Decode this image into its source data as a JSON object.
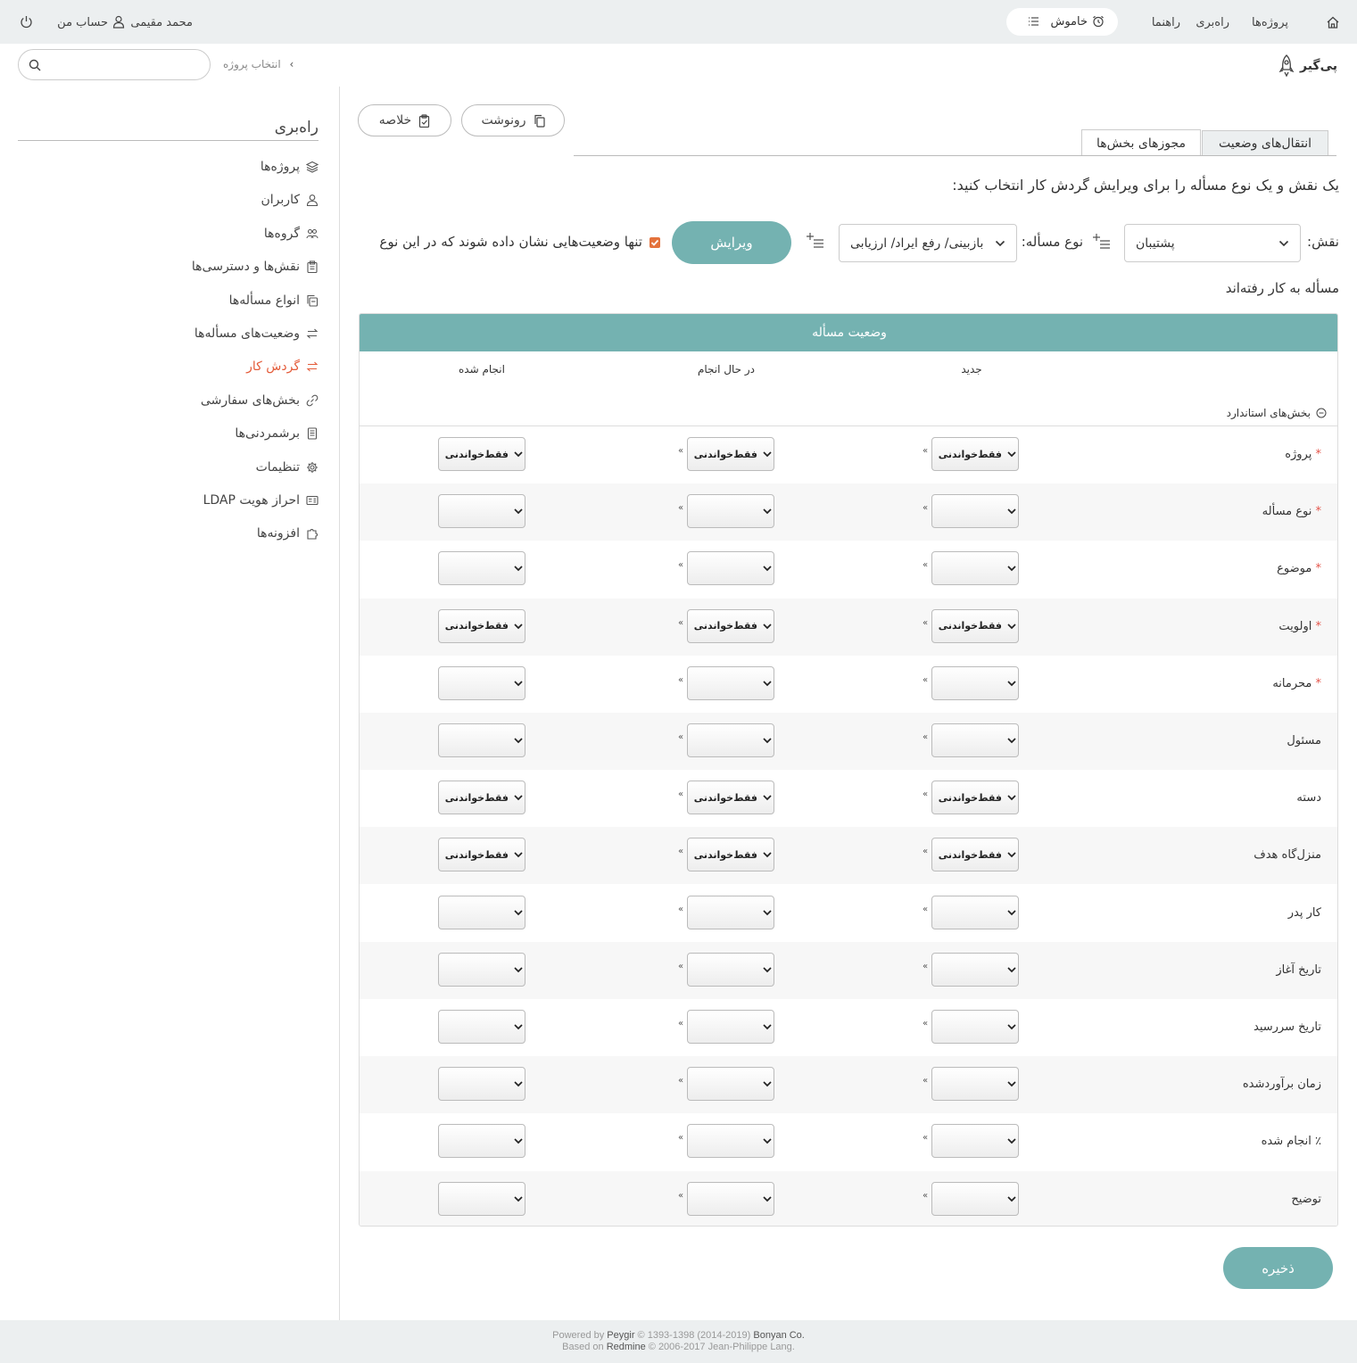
{
  "topbar": {
    "nav": [
      "پروژه‌ها",
      "راه‌بری",
      "راهنما"
    ],
    "timer_label": "خاموش",
    "user_name": "محمد مقیمی",
    "account_label": "حساب من"
  },
  "header": {
    "brand": "پی‌گیر",
    "breadcrumb": "انتخاب پروژه",
    "search_placeholder": ""
  },
  "sidebar": {
    "title": "راه‌بری",
    "items": [
      {
        "label": "پروژه‌ها",
        "icon": "layers-icon"
      },
      {
        "label": "کاربران",
        "icon": "user-icon"
      },
      {
        "label": "گروه‌ها",
        "icon": "group-icon"
      },
      {
        "label": "نقش‌ها و دسترسی‌ها",
        "icon": "clipboard-icon"
      },
      {
        "label": "انواع مسأله‌ها",
        "icon": "copy-icon"
      },
      {
        "label": "وضعیت‌های مسأله‌ها",
        "icon": "swap-icon"
      },
      {
        "label": "گردش کار",
        "icon": "workflow-icon",
        "active": true
      },
      {
        "label": "بخش‌های سفارشی",
        "icon": "link-icon"
      },
      {
        "label": "برشمردنی‌ها",
        "icon": "list-doc-icon"
      },
      {
        "label": "تنظیمات",
        "icon": "gear-icon"
      },
      {
        "label": "احراز هویت LDAP",
        "icon": "id-card-icon"
      },
      {
        "label": "افزونه‌ها",
        "icon": "puzzle-icon"
      }
    ]
  },
  "actions": {
    "copy_label": "رونوشت",
    "summary_label": "خلاصه"
  },
  "tabs": [
    {
      "label": "انتقال‌های وضعیت",
      "selected": false
    },
    {
      "label": "مجوزهای بخش‌ها",
      "selected": true
    }
  ],
  "instruction": "یک نقش و یک نوع مسأله را برای ویرایش گردش کار انتخاب کنید:",
  "filters": {
    "role_label": "نقش:",
    "role_value": "پشتیبان",
    "tracker_label": "نوع مسأله:",
    "tracker_value": "بازبینی/ رفع ایراد/ ارزیابی",
    "edit_label": "ویرایش",
    "only_used_label": "تنها وضعیت‌هایی نشان داده شوند که در این نوع",
    "only_used_label_2": "مسأله به کار رفته‌اند",
    "only_used_checked": true
  },
  "table": {
    "header": "وضعیت مسأله",
    "columns": [
      "جدید",
      "در حال انجام",
      "انجام شده"
    ],
    "section": "بخش‌های استاندارد",
    "arrow": "»",
    "rows": [
      {
        "label": "پروژه",
        "required": true,
        "values": [
          "فقط‌خواندنی",
          "فقط‌خواندنی",
          "فقط‌خواندنی"
        ]
      },
      {
        "label": "نوع مسأله",
        "required": true,
        "values": [
          "",
          "",
          ""
        ]
      },
      {
        "label": "موضوع",
        "required": true,
        "values": [
          "",
          "",
          ""
        ]
      },
      {
        "label": "اولویت",
        "required": true,
        "values": [
          "فقط‌خواندنی",
          "فقط‌خواندنی",
          "فقط‌خواندنی"
        ]
      },
      {
        "label": "محرمانه",
        "required": true,
        "values": [
          "",
          "",
          ""
        ]
      },
      {
        "label": "مسئول",
        "required": false,
        "values": [
          "",
          "",
          ""
        ]
      },
      {
        "label": "دسته",
        "required": false,
        "values": [
          "فقط‌خواندنی",
          "فقط‌خواندنی",
          "فقط‌خواندنی"
        ]
      },
      {
        "label": "منزل‌گاه هدف",
        "required": false,
        "values": [
          "فقط‌خواندنی",
          "فقط‌خواندنی",
          "فقط‌خواندنی"
        ]
      },
      {
        "label": "کار پدر",
        "required": false,
        "values": [
          "",
          "",
          ""
        ]
      },
      {
        "label": "تاریخ آغاز",
        "required": false,
        "values": [
          "",
          "",
          ""
        ]
      },
      {
        "label": "تاریخ سررسید",
        "required": false,
        "values": [
          "",
          "",
          ""
        ]
      },
      {
        "label": "زمان برآوردشده",
        "required": false,
        "values": [
          "",
          "",
          ""
        ]
      },
      {
        "label": "٪ انجام شده",
        "required": false,
        "values": [
          "",
          "",
          ""
        ]
      },
      {
        "label": "توضیح",
        "required": false,
        "values": [
          "",
          "",
          ""
        ]
      }
    ]
  },
  "save_label": "ذخیره",
  "footer": {
    "line1_prefix": "Powered by",
    "line1_link": "Peygir",
    "line1_mid": "© 1393-1398 (2014-2019)",
    "line1_company": "Bonyan Co.",
    "line2_prefix": "Based on",
    "line2_link": "Redmine",
    "line2_rest": "© 2006-2017 Jean-Philippe Lang."
  },
  "colors": {
    "accent": "#74b2b1",
    "active": "#e45c3a",
    "topbar": "#eceff0",
    "checkbox": "#e4723c",
    "required": "#e4544a"
  }
}
